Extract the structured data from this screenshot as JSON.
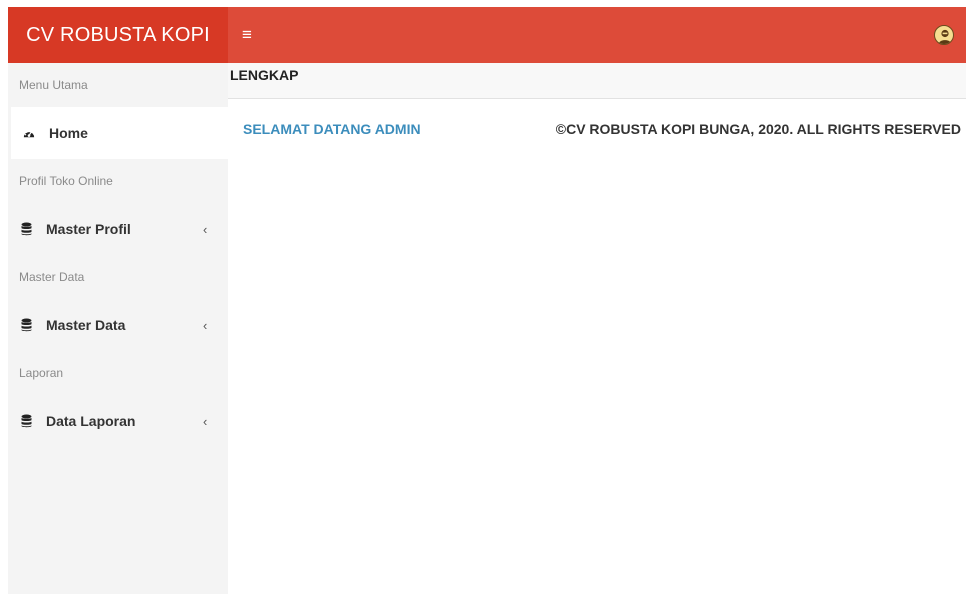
{
  "header": {
    "brand": "CV ROBUSTA KOPI",
    "toggle_icon": "≡",
    "avatar_icon": "user-avatar-icon"
  },
  "sidebar": {
    "sections": [
      {
        "header": "Menu Utama",
        "item": {
          "label": "Home",
          "icon": "dashboard-icon",
          "active": true
        }
      },
      {
        "header": "Profil Toko Online",
        "item": {
          "label": "Master Profil",
          "icon": "database-icon",
          "chevron": "‹"
        }
      },
      {
        "header": "Master Data",
        "item": {
          "label": "Master Data",
          "icon": "database-icon",
          "chevron": "‹"
        }
      },
      {
        "header": "Laporan",
        "item": {
          "label": "Data Laporan",
          "icon": "database-icon",
          "chevron": "‹"
        }
      }
    ]
  },
  "content": {
    "title": "LENGKAP",
    "welcome": "SELAMAT DATANG ADMIN",
    "copyright": "©CV ROBUSTA KOPI BUNGA, 2020. ALL RIGHTS RESERVED"
  },
  "colors": {
    "brand_bg": "#d73925",
    "navbar_bg": "#dd4b39",
    "sidebar_bg": "#f4f4f4",
    "link": "#3c8dbc"
  }
}
